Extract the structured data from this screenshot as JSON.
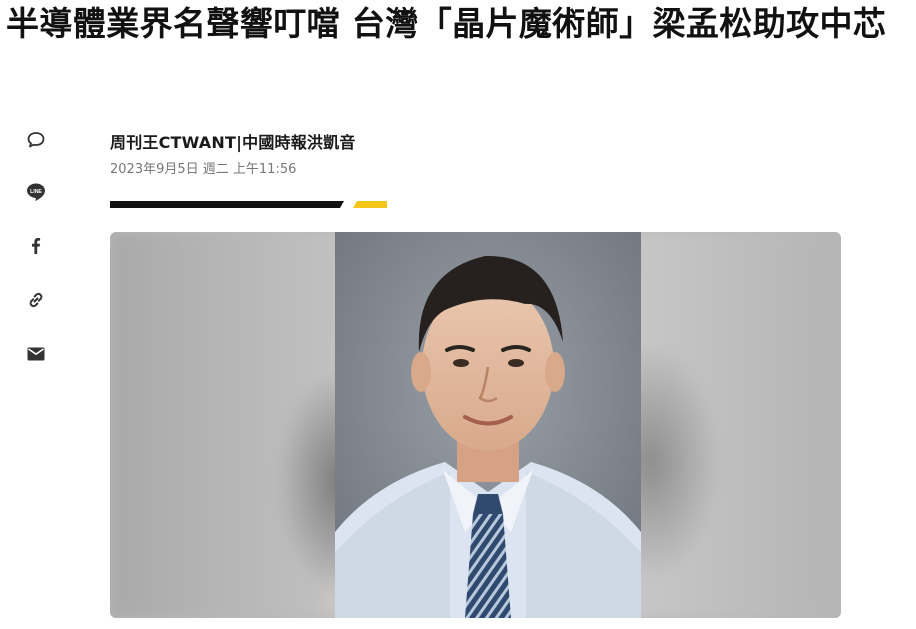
{
  "article": {
    "headline": "半導體業界名聲響叮噹 台灣「晶片魔術師」梁孟松助攻中芯",
    "byline": "周刊王CTWANT|中國時報洪凱音",
    "timestamp": "2023年9月5日 週二 上午11:56"
  },
  "share": {
    "items": [
      {
        "icon": "comment-icon"
      },
      {
        "icon": "line-icon",
        "label": "LINE"
      },
      {
        "icon": "facebook-icon",
        "label": "f"
      },
      {
        "icon": "link-icon"
      },
      {
        "icon": "mail-icon"
      }
    ]
  },
  "colors": {
    "accent_yellow": "#f5c518",
    "rule_black": "#111111",
    "icon_gray": "#333333"
  }
}
